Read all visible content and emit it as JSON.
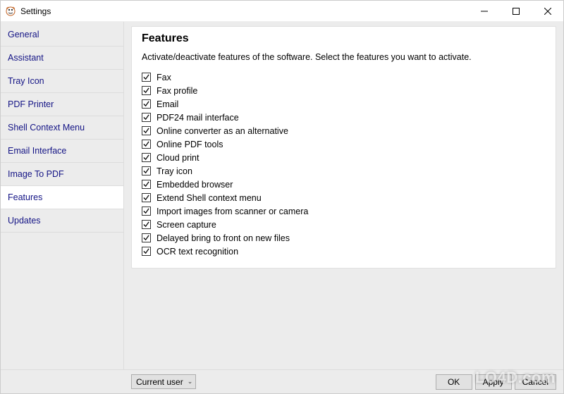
{
  "window": {
    "title": "Settings"
  },
  "sidebar": {
    "items": [
      {
        "label": "General",
        "active": false
      },
      {
        "label": "Assistant",
        "active": false
      },
      {
        "label": "Tray Icon",
        "active": false
      },
      {
        "label": "PDF Printer",
        "active": false
      },
      {
        "label": "Shell Context Menu",
        "active": false
      },
      {
        "label": "Email Interface",
        "active": false
      },
      {
        "label": "Image To PDF",
        "active": false
      },
      {
        "label": "Features",
        "active": true
      },
      {
        "label": "Updates",
        "active": false
      }
    ]
  },
  "main": {
    "heading": "Features",
    "description": "Activate/deactivate features of the software. Select the features you want to activate.",
    "features": [
      {
        "label": "Fax",
        "checked": true
      },
      {
        "label": "Fax profile",
        "checked": true
      },
      {
        "label": "Email",
        "checked": true
      },
      {
        "label": "PDF24 mail interface",
        "checked": true
      },
      {
        "label": "Online converter as an alternative",
        "checked": true
      },
      {
        "label": "Online PDF tools",
        "checked": true
      },
      {
        "label": "Cloud print",
        "checked": true
      },
      {
        "label": "Tray icon",
        "checked": true
      },
      {
        "label": "Embedded browser",
        "checked": true
      },
      {
        "label": "Extend Shell context menu",
        "checked": true
      },
      {
        "label": "Import images from scanner or camera",
        "checked": true
      },
      {
        "label": "Screen capture",
        "checked": true
      },
      {
        "label": "Delayed bring to front on new files",
        "checked": true
      },
      {
        "label": "OCR text recognition",
        "checked": true
      }
    ]
  },
  "footer": {
    "scope_label": "Current user",
    "buttons": {
      "ok": "OK",
      "apply": "Apply",
      "cancel": "Cancel"
    }
  },
  "watermark": "LO4D.com"
}
